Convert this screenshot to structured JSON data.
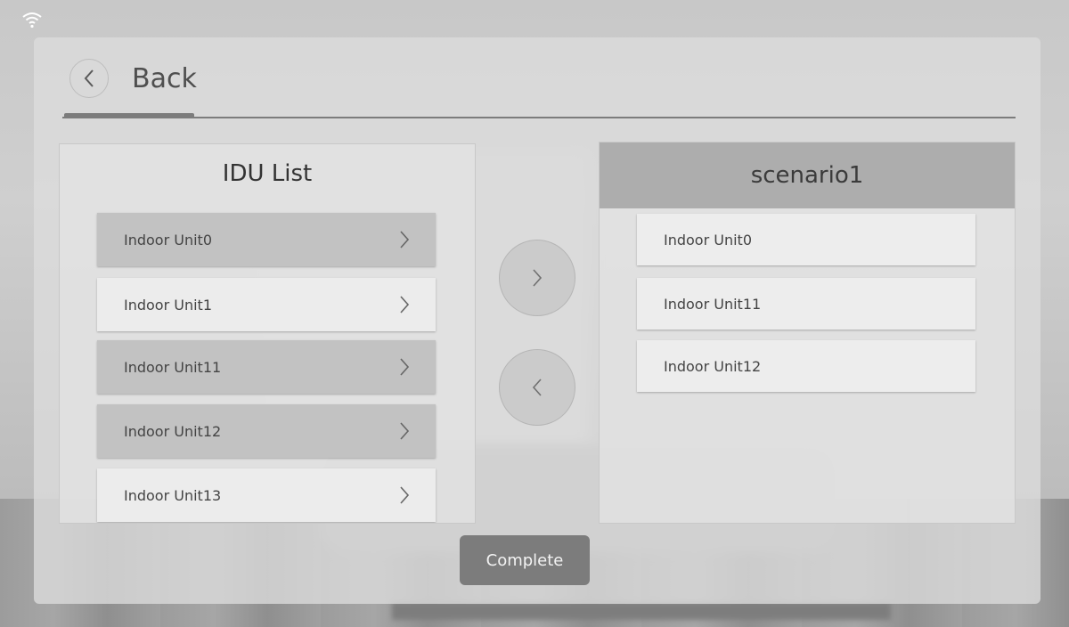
{
  "header": {
    "back_label": "Back"
  },
  "idu_list": {
    "title": "IDU List",
    "items": [
      {
        "label": "Indoor Unit0",
        "selected": true
      },
      {
        "label": "Indoor Unit1",
        "selected": false
      },
      {
        "label": "Indoor Unit11",
        "selected": true
      },
      {
        "label": "Indoor Unit12",
        "selected": true
      },
      {
        "label": "Indoor Unit13",
        "selected": false
      }
    ]
  },
  "scenario": {
    "title": "scenario1",
    "items": [
      {
        "label": "Indoor Unit0"
      },
      {
        "label": "Indoor Unit11"
      },
      {
        "label": "Indoor Unit12"
      }
    ]
  },
  "buttons": {
    "add_icon": "chevron-right-icon",
    "remove_icon": "chevron-left-icon",
    "complete_label": "Complete"
  },
  "colors": {
    "selected_row": "#c2c2c2",
    "unselected_row": "#ececec",
    "scenario_header": "#adadad",
    "complete_button": "#7c7c7c"
  }
}
